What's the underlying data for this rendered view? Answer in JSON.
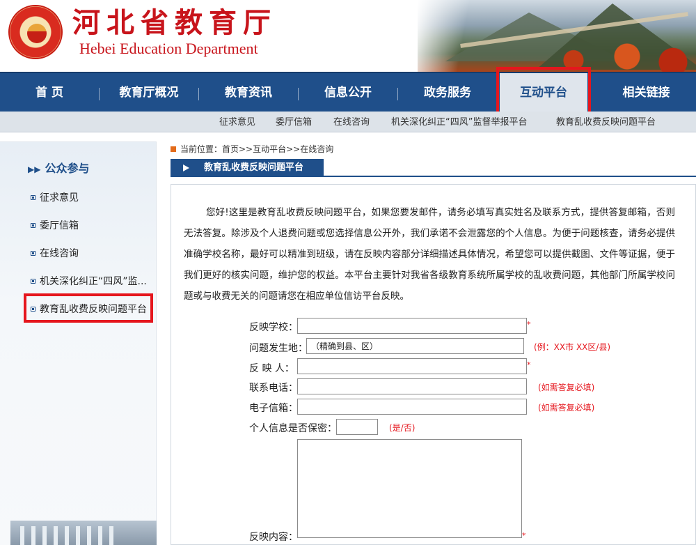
{
  "header": {
    "title_cn": "河北省教育厅",
    "title_en": "Hebei Education Department"
  },
  "nav": {
    "items": [
      {
        "label": "首 页"
      },
      {
        "label": "教育厅概况"
      },
      {
        "label": "教育资讯"
      },
      {
        "label": "信息公开"
      },
      {
        "label": "政务服务"
      },
      {
        "label": "互动平台",
        "active": true
      },
      {
        "label": "相关链接"
      }
    ]
  },
  "subnav": {
    "items": [
      "征求意见",
      "委厅信箱",
      "在线咨询",
      "机关深化纠正“四风”监督举报平台",
      "教育乱收费反映问题平台"
    ]
  },
  "sidebar": {
    "title": "公众参与",
    "items": [
      "征求意见",
      "委厅信箱",
      "在线咨询",
      "机关深化纠正“四风”监...",
      "教育乱收费反映问题平台"
    ]
  },
  "breadcrumb": "当前位置：首页>>互动平台>>在线咨询",
  "tab_title": "教育乱收费反映问题平台",
  "intro": "您好!这里是教育乱收费反映问题平台，如果您要发邮件，请务必填写真实姓名及联系方式，提供答复邮箱，否则无法答复。除涉及个人退费问题或您选择信息公开外，我们承诺不会泄露您的个人信息。为便于问题核查，请务必提供准确学校名称，最好可以精准到班级，请在反映内容部分详细描述具体情况，希望您可以提供截图、文件等证据，便于我们更好的核实问题，维护您的权益。本平台主要针对我省各级教育系统所属学校的乱收费问题，其他部门所属学校问题或与收费无关的问题请您在相应单位信访平台反映。",
  "form": {
    "school_label": "反映学校：",
    "school_value": "",
    "location_label": "问题发生地：",
    "location_value": "（精确到县、区）",
    "location_hint": "(例：XX市 XX区/县)",
    "reporter_label": "反 映 人：",
    "reporter_value": "",
    "phone_label": "联系电话：",
    "phone_value": "",
    "phone_hint": "(如需答复必填)",
    "email_label": "电子信箱：",
    "email_value": "",
    "email_hint": "(如需答复必填)",
    "privacy_label": "个人信息是否保密：",
    "privacy_value": "",
    "privacy_hint": "(是/否)",
    "content_label": "反映内容：",
    "content_value": "",
    "required_mark": "*"
  },
  "colors": {
    "brand_blue": "#1f4f8a",
    "brand_red": "#c8141b",
    "highlight": "#e5161d"
  }
}
